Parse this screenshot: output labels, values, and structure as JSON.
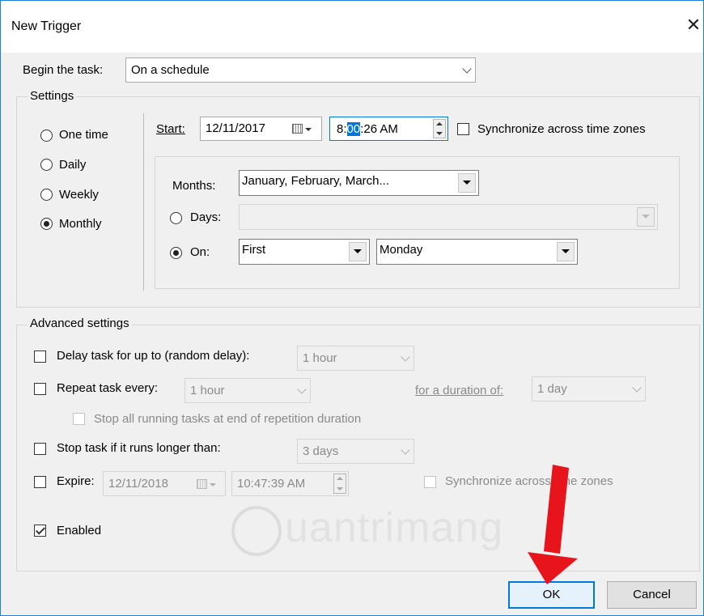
{
  "window": {
    "title": "New Trigger"
  },
  "begin": {
    "label": "Begin the task:",
    "value": "On a schedule"
  },
  "settings": {
    "legend": "Settings",
    "options": [
      "One time",
      "Daily",
      "Weekly",
      "Monthly"
    ],
    "selected": "Monthly",
    "start_label": "Start:",
    "start_date": "12/11/2017",
    "start_time_pre": "8:",
    "start_time_sel": "00",
    "start_time_post": ":26 AM",
    "sync_label": "Synchronize across time zones",
    "months_label": "Months:",
    "months_value": "January, February, March...",
    "days_label": "Days:",
    "days_value": "",
    "on_label": "On:",
    "on_week": "First",
    "on_day": "Monday"
  },
  "advanced": {
    "legend": "Advanced settings",
    "delay_label": "Delay task for up to (random delay):",
    "delay_value": "1 hour",
    "repeat_label": "Repeat task every:",
    "repeat_value": "1 hour",
    "duration_label": "for a duration of:",
    "duration_value": "1 day",
    "stop_all_label": "Stop all running tasks at end of repetition duration",
    "stop_label": "Stop task if it runs longer than:",
    "stop_value": "3 days",
    "expire_label": "Expire:",
    "expire_date": "12/11/2018",
    "expire_time": "10:47:39 AM",
    "expire_sync_label": "Synchronize across time zones",
    "enabled_label": "Enabled"
  },
  "watermark": "uantrimang",
  "buttons": {
    "ok": "OK",
    "cancel": "Cancel"
  },
  "colors": {
    "accent": "#0078d7",
    "arrow": "#e8141b"
  }
}
